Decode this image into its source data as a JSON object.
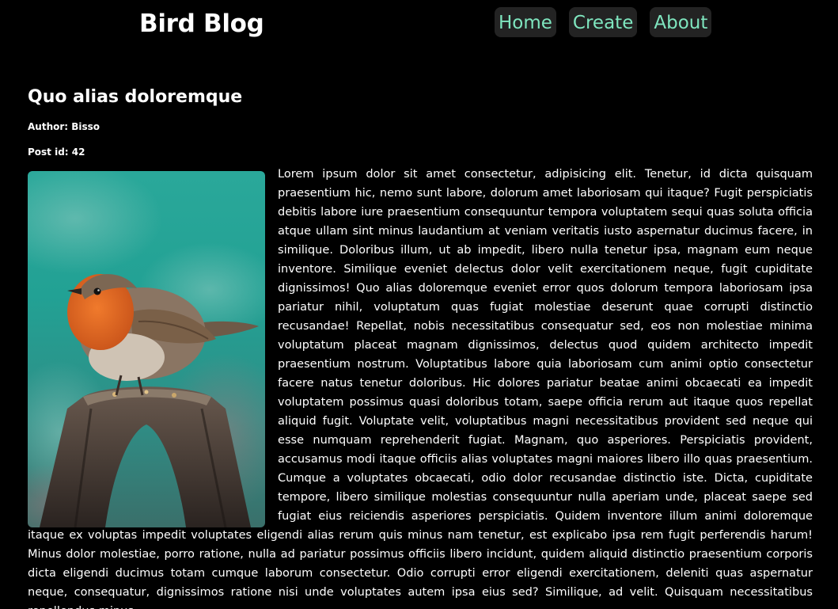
{
  "header": {
    "site_title": "Bird Blog",
    "nav": [
      {
        "label": "Home"
      },
      {
        "label": "Create"
      },
      {
        "label": "About"
      }
    ]
  },
  "post": {
    "title": "Quo alias doloremque",
    "author": "Author: Bisso",
    "post_id": "Post id: 42",
    "image_icon": "robin-bird-photo",
    "body": "Lorem ipsum dolor sit amet consectetur, adipisicing elit. Tenetur, id dicta quisquam praesentium hic, nemo sunt labore, dolorum amet laboriosam qui itaque? Fugit perspiciatis debitis labore iure praesentium consequuntur tempora voluptatem sequi quas soluta officia atque ullam sint minus laudantium at veniam veritatis iusto aspernatur ducimus facere, in similique. Doloribus illum, ut ab impedit, libero nulla tenetur ipsa, magnam eum neque inventore. Similique eveniet delectus dolor velit exercitationem neque, fugit cupiditate dignissimos! Quo alias doloremque eveniet error quos dolorum tempora laboriosam ipsa pariatur nihil, voluptatum quas fugiat molestiae deserunt quae corrupti distinctio recusandae! Repellat, nobis necessitatibus consequatur sed, eos non molestiae minima voluptatum placeat magnam dignissimos, delectus quod quidem architecto impedit praesentium nostrum. Voluptatibus labore quia laboriosam cum animi optio consectetur facere natus tenetur doloribus. Hic dolores pariatur beatae animi obcaecati ea impedit voluptatem possimus quasi doloribus totam, saepe officia rerum aut itaque quos repellat aliquid fugit. Voluptate velit, voluptatibus magni necessitatibus provident sed neque qui esse numquam reprehenderit fugiat. Magnam, quo asperiores. Perspiciatis provident, accusamus modi itaque officiis alias voluptates magni maiores libero illo quas praesentium. Cumque a voluptates obcaecati, odio dolor recusandae distinctio iste. Dicta, cupiditate tempore, libero similique molestias consequuntur nulla aperiam unde, placeat saepe sed fugiat eius reiciendis asperiores perspiciatis. Quidem inventore illum animi doloremque itaque ex voluptas impedit voluptates eligendi alias rerum quis minus nam tenetur, est explicabo ipsa rem fugit perferendis harum! Minus dolor molestiae, porro ratione, nulla ad pariatur possimus officiis libero incidunt, quidem aliquid distinctio praesentium corporis dicta eligendi ducimus totam cumque laborum consectetur. Odio corrupti error eligendi exercitationem, deleniti quas aspernatur neque, consequatur, dignissimos ratione nisi unde voluptates autem ipsa eius sed? Similique, ad velit. Quisquam necessitatibus repellendus minus"
  },
  "colors": {
    "background": "#000000",
    "nav_bg": "#232323",
    "nav_link": "#7fe6bf",
    "text": "#ffffff"
  }
}
